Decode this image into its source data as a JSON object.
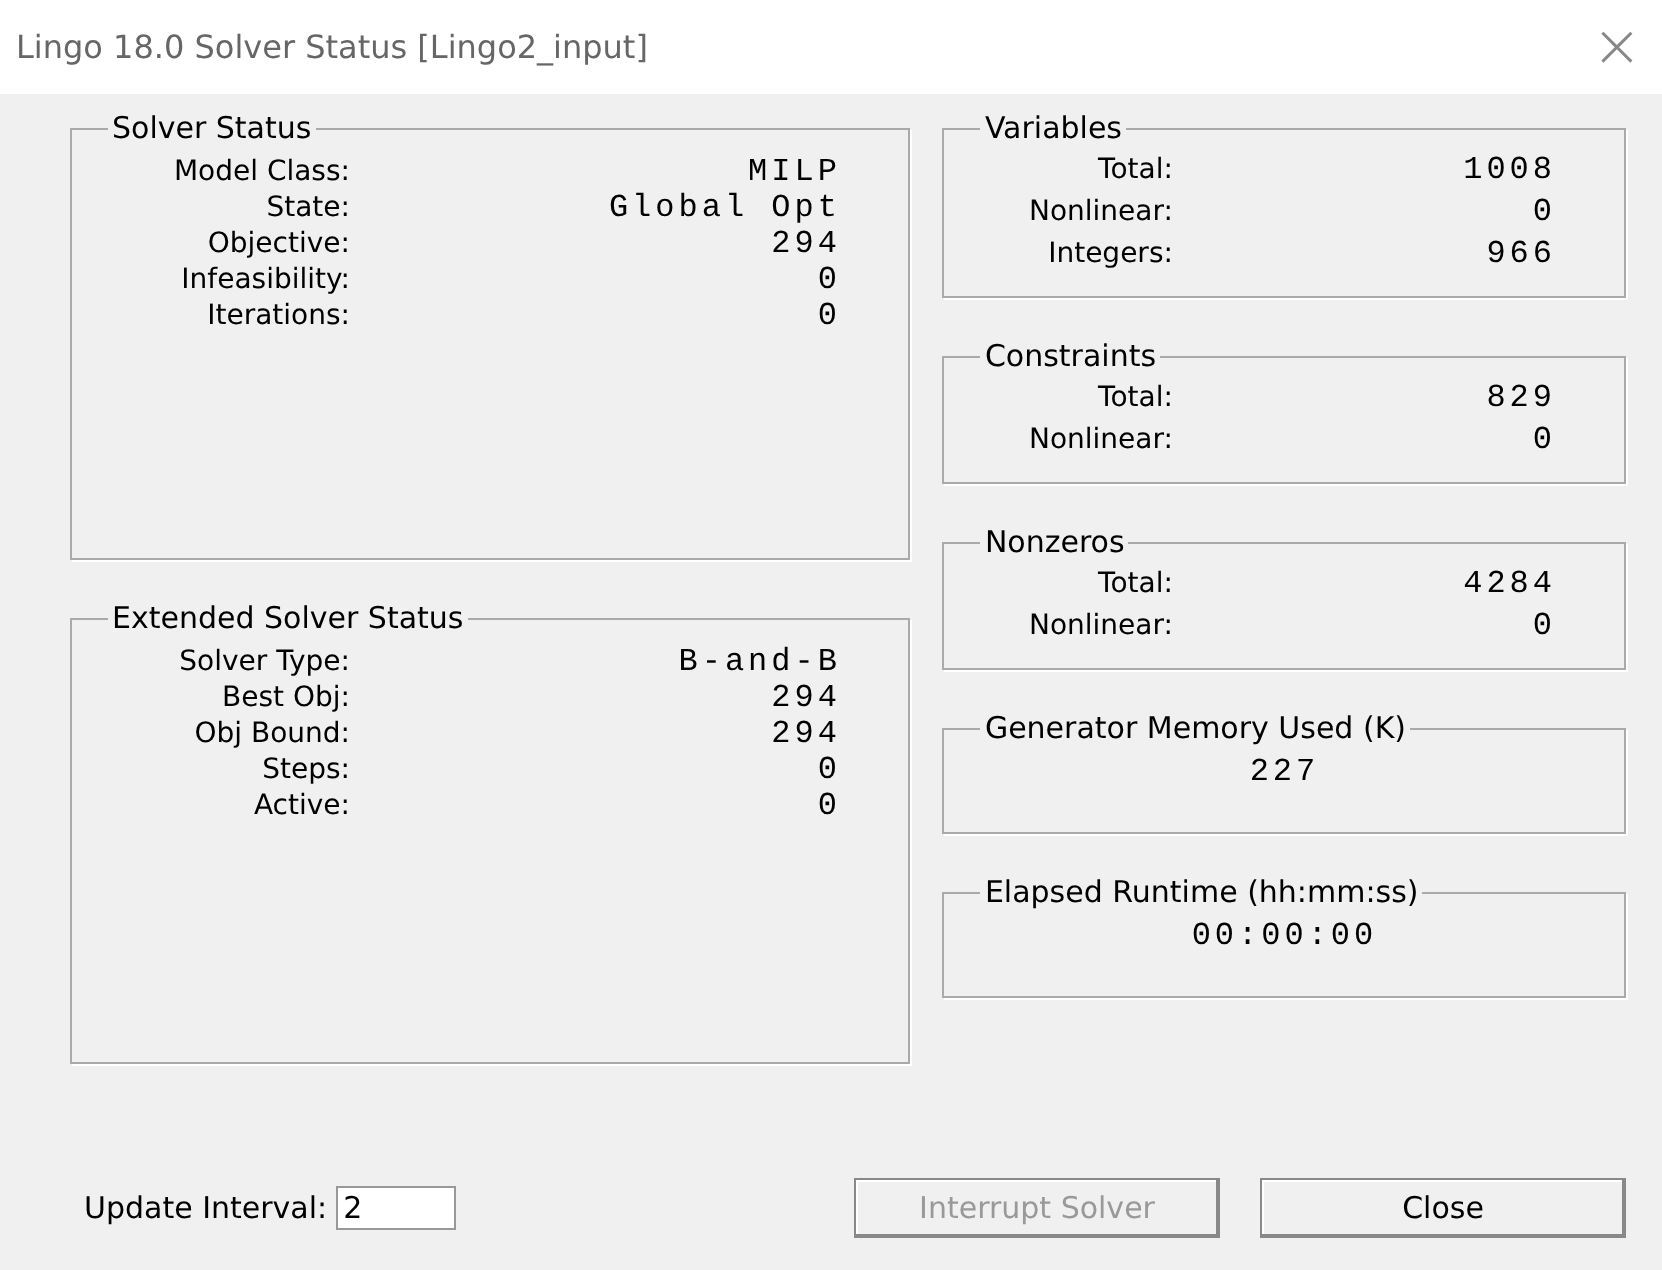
{
  "window": {
    "title": "Lingo 18.0 Solver Status [Lingo2_input]",
    "close": "×"
  },
  "left_groups": [
    {
      "title": "Solver Status",
      "rows": [
        {
          "label": "Model Class:",
          "value": "MILP"
        },
        {
          "label": "State:",
          "value": "Global Opt"
        },
        {
          "label": "Objective:",
          "value": "294"
        },
        {
          "label": "Infeasibility:",
          "value": "0"
        },
        {
          "label": "Iterations:",
          "value": "0"
        }
      ]
    },
    {
      "title": "Extended Solver Status",
      "rows": [
        {
          "label": "Solver Type:",
          "value": "B-and-B"
        },
        {
          "label": "Best Obj:",
          "value": "294"
        },
        {
          "label": "Obj Bound:",
          "value": "294"
        },
        {
          "label": "Steps:",
          "value": "0"
        },
        {
          "label": "Active:",
          "value": "0"
        }
      ]
    }
  ],
  "right_groups": [
    {
      "kind": "rows",
      "title": "Variables",
      "rows": [
        {
          "label": "Total:",
          "value": "1008"
        },
        {
          "label": "Nonlinear:",
          "value": "0"
        },
        {
          "label": "Integers:",
          "value": "966"
        }
      ]
    },
    {
      "kind": "rows",
      "title": "Constraints",
      "rows": [
        {
          "label": "Total:",
          "value": "829"
        },
        {
          "label": "Nonlinear:",
          "value": "0"
        }
      ]
    },
    {
      "kind": "rows",
      "title": "Nonzeros",
      "rows": [
        {
          "label": "Total:",
          "value": "4284"
        },
        {
          "label": "Nonlinear:",
          "value": "0"
        }
      ]
    },
    {
      "kind": "single",
      "title": "Generator Memory Used (K)",
      "value": "227"
    },
    {
      "kind": "single",
      "title": "Elapsed Runtime (hh:mm:ss)",
      "value": "00:00:00"
    }
  ],
  "update_interval": {
    "label": "Update Interval:",
    "value": "2"
  },
  "buttons": [
    {
      "label": "Interrupt Solver",
      "disabled": true
    },
    {
      "label": "Close",
      "disabled": false
    }
  ]
}
